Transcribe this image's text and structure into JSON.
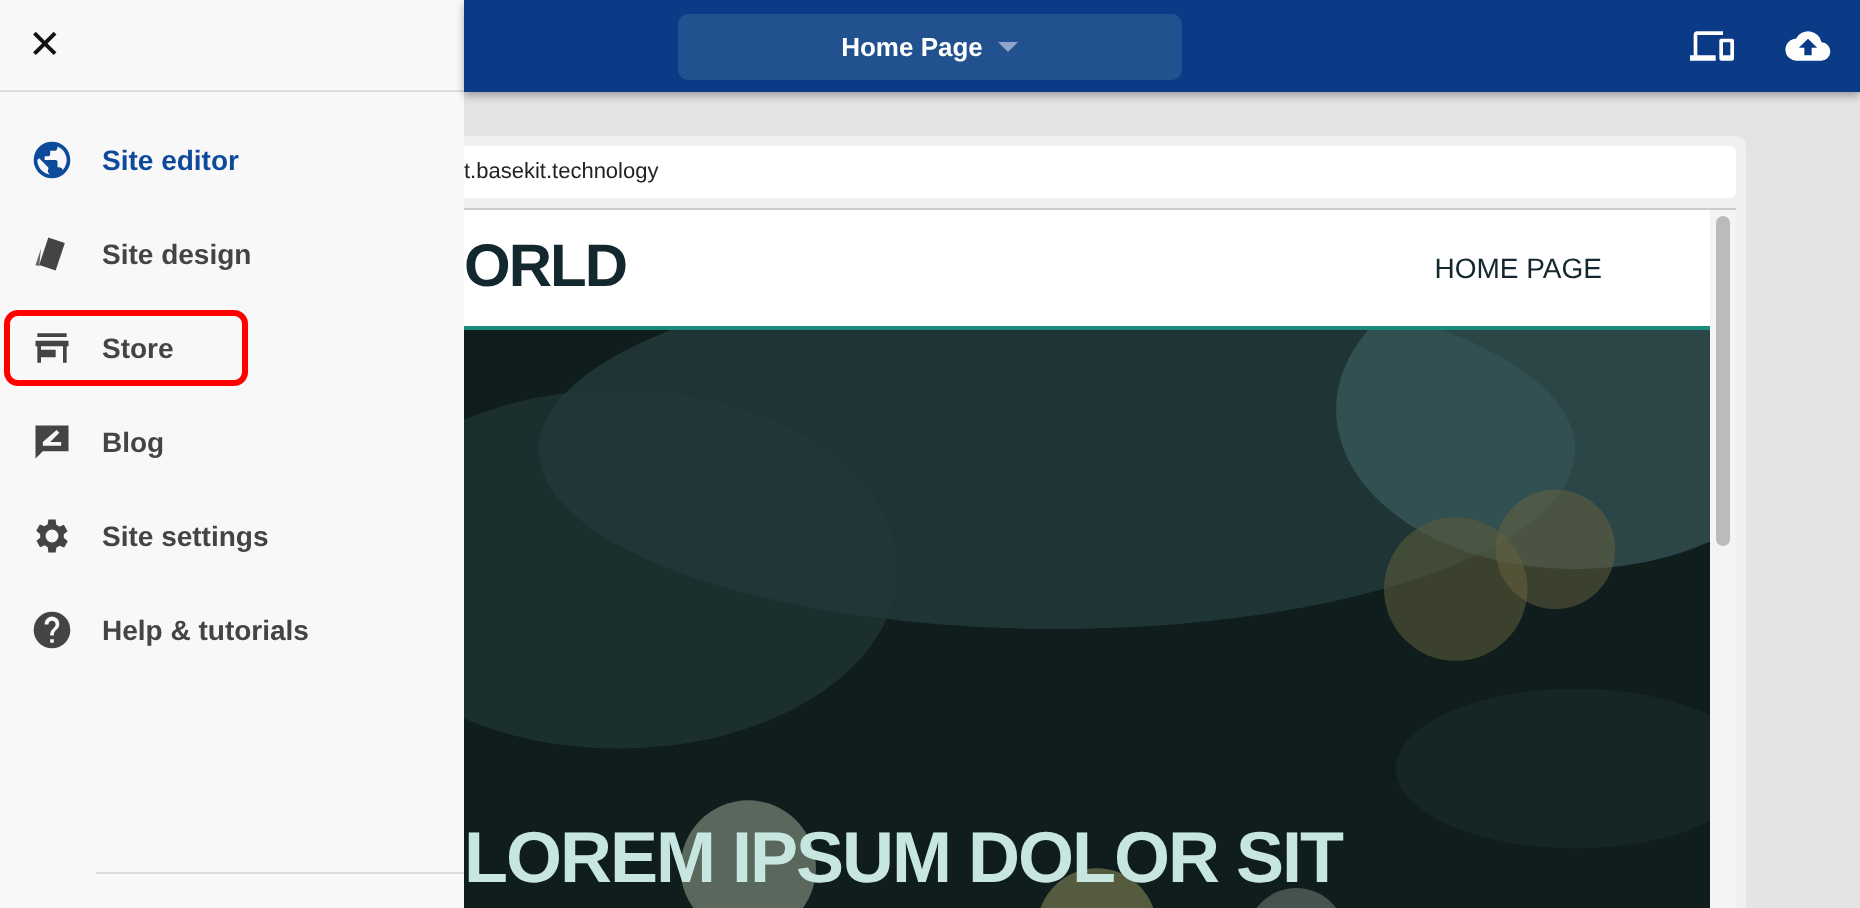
{
  "topbar": {
    "page_selector": "Home Page"
  },
  "sidebar": {
    "close": "✕",
    "items": [
      {
        "kind": "globe",
        "label": "Site editor",
        "selected": true,
        "highlighted": false
      },
      {
        "kind": "design",
        "label": "Site design",
        "selected": false,
        "highlighted": false
      },
      {
        "kind": "store",
        "label": "Store",
        "selected": false,
        "highlighted": true
      },
      {
        "kind": "blog",
        "label": "Blog",
        "selected": false,
        "highlighted": false
      },
      {
        "kind": "settings",
        "label": "Site settings",
        "selected": false,
        "highlighted": false
      },
      {
        "kind": "help",
        "label": "Help & tutorials",
        "selected": false,
        "highlighted": false
      }
    ]
  },
  "preview": {
    "url": "t.basekit.technology",
    "logo": "ORLD",
    "nav": "HOME PAGE",
    "hero": {
      "kind": "picture",
      "title": "LOREM IPSUM DOLOR SIT"
    }
  }
}
